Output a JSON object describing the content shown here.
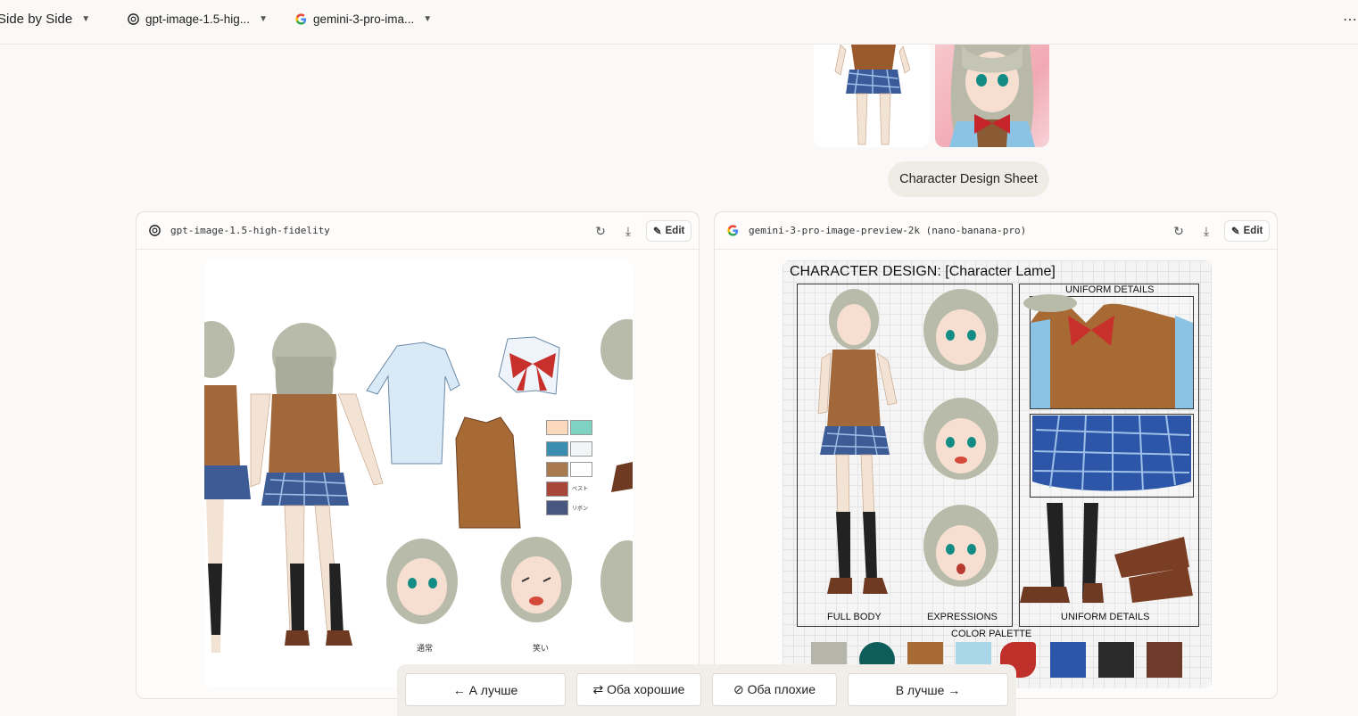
{
  "topbar": {
    "mode_label": "Side by Side",
    "model_a_label": "gpt-image-1.5-hig...",
    "model_b_label": "gemini-3-pro-ima...",
    "more_label": "⋯"
  },
  "prompt": {
    "text": "Character Design Sheet"
  },
  "panels": {
    "left": {
      "model_name": "gpt-image-1.5-high-fidelity",
      "edit_label": "Edit",
      "image": {
        "expression_labels": [
          "通常",
          "笑い"
        ],
        "swatch_labels": [
          "ベスト",
          "リボン"
        ],
        "swatch_colors": [
          "#fbd9bd",
          "#7fd1c1",
          "#3a8fb0",
          "#f2f5f6",
          "#a97a4e",
          "#ffffff",
          "#a8463a",
          "#47577f"
        ]
      }
    },
    "right": {
      "model_name": "gemini-3-pro-image-preview-2k (nano-banana-pro)",
      "edit_label": "Edit",
      "image": {
        "title": "CHARACTER DESIGN: [Character Lame]",
        "uniform_details_top": "UNIFORM DETAILS",
        "full_body": "FULL BODY",
        "expressions": "EXPRESSIONS",
        "uniform_details_bottom": "UNIFORM DETAILS",
        "color_palette": "COLOR PALETTE",
        "palette_colors": [
          "#b5b5a9",
          "#0e5d5a",
          "#a86a35",
          "#a9d6e9",
          "#c0302b",
          "#2e56a8",
          "#2b2b2b",
          "#6e3b2a"
        ]
      }
    }
  },
  "vote": {
    "a_better": "← А лучше",
    "both_good": "⇄ Оба хорошие",
    "both_bad": "⊘ Оба плохие",
    "b_better": "В лучше →"
  }
}
